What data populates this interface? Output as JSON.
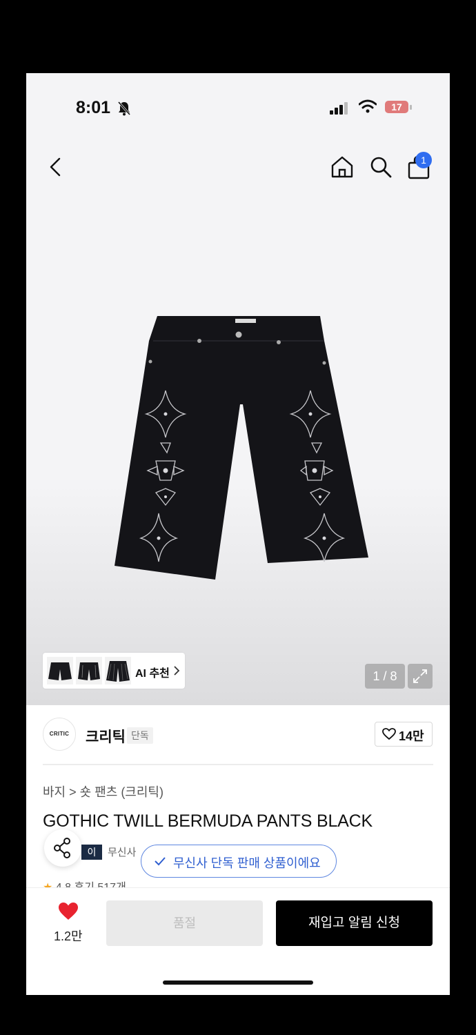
{
  "status_bar": {
    "time": "8:01",
    "battery": "17"
  },
  "nav": {
    "cart_count": "1"
  },
  "gallery": {
    "ai_label": "AI 추천",
    "page_indicator": "1 / 8"
  },
  "brand": {
    "logo_text": "CRITIC",
    "name": "크리틱",
    "tag": "단독",
    "likes": "14만"
  },
  "product": {
    "breadcrumb": "바지 > 숏 팬츠 (크리틱)",
    "title": "GOTHIC TWILL BERMUDA PANTS BLACK",
    "pay_badge": "이",
    "pay_text": "무신사",
    "rating": "4.8",
    "reviews": "후기 517개"
  },
  "toast": {
    "text": "무신사 단독 판매 상품이에요"
  },
  "bottom_bar": {
    "wish_count": "1.2만",
    "soldout_label": "품절",
    "restock_label": "재입고 알림 신청"
  },
  "colors": {
    "accent_blue": "#2f6df0",
    "heart_red": "#e8232f",
    "toast_blue": "#2f5fd0"
  }
}
